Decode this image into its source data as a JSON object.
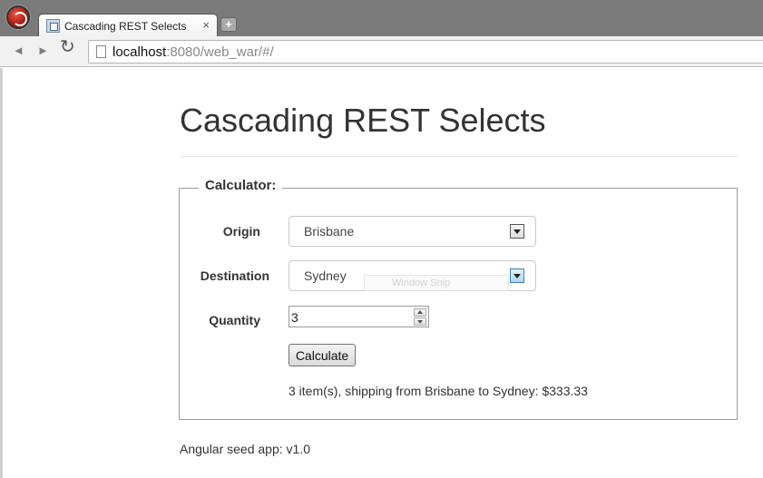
{
  "browser": {
    "tab_title": "Cascading REST Selects",
    "tab_close": "×",
    "new_tab": "+",
    "url_host": "localhost",
    "url_rest": ":8080/web_war/#/",
    "back": "◄",
    "forward": "►",
    "reload": "↻"
  },
  "page": {
    "title": "Cascading REST Selects",
    "calculator": {
      "legend": "Calculator:",
      "origin_label": "Origin",
      "origin_value": "Brisbane",
      "destination_label": "Destination",
      "destination_value": "Sydney",
      "quantity_label": "Quantity",
      "quantity_value": "3",
      "calculate_label": "Calculate",
      "result": "3 item(s), shipping from Brisbane to Sydney: $333.33"
    },
    "overlay_text": "Window Snip",
    "footer": "Angular seed app: v1.0"
  }
}
